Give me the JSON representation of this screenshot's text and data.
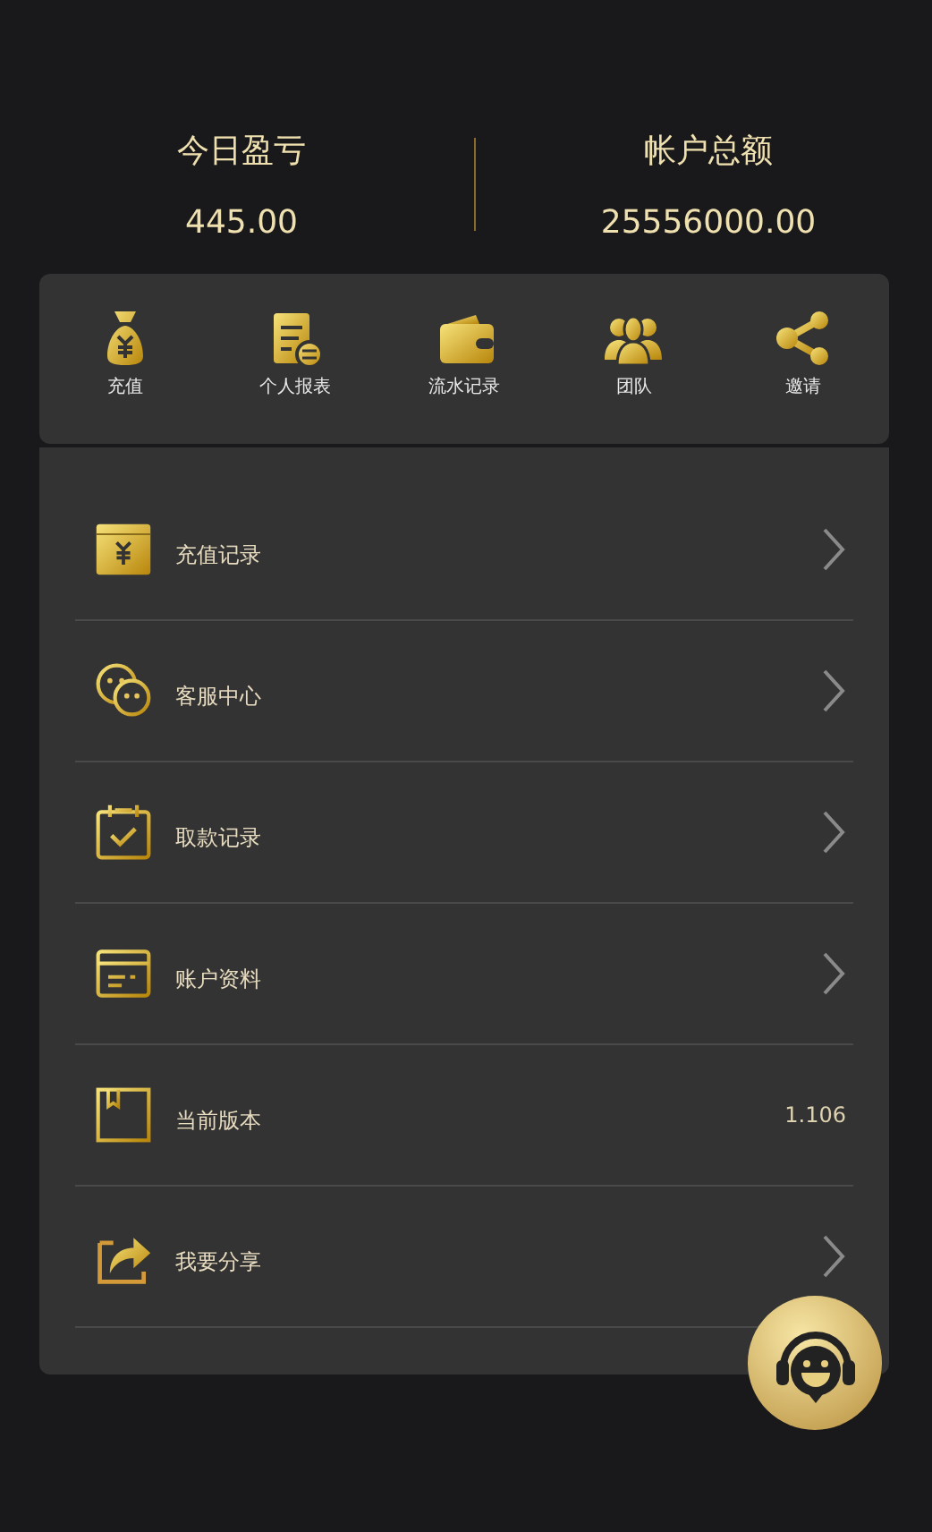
{
  "stats": [
    {
      "label": "今日盈亏",
      "value": "445.00"
    },
    {
      "label": "帐户总额",
      "value": "25556000.00"
    }
  ],
  "shortcuts": [
    {
      "label": "充值"
    },
    {
      "label": "个人报表"
    },
    {
      "label": "流水记录"
    },
    {
      "label": "团队"
    },
    {
      "label": "邀请"
    }
  ],
  "menu": [
    {
      "label": "充值记录",
      "kind": "link"
    },
    {
      "label": "客服中心",
      "kind": "link"
    },
    {
      "label": "取款记录",
      "kind": "link"
    },
    {
      "label": "账户资料",
      "kind": "link"
    },
    {
      "label": "当前版本",
      "kind": "value",
      "value": "1.106"
    },
    {
      "label": "我要分享",
      "kind": "link"
    }
  ]
}
